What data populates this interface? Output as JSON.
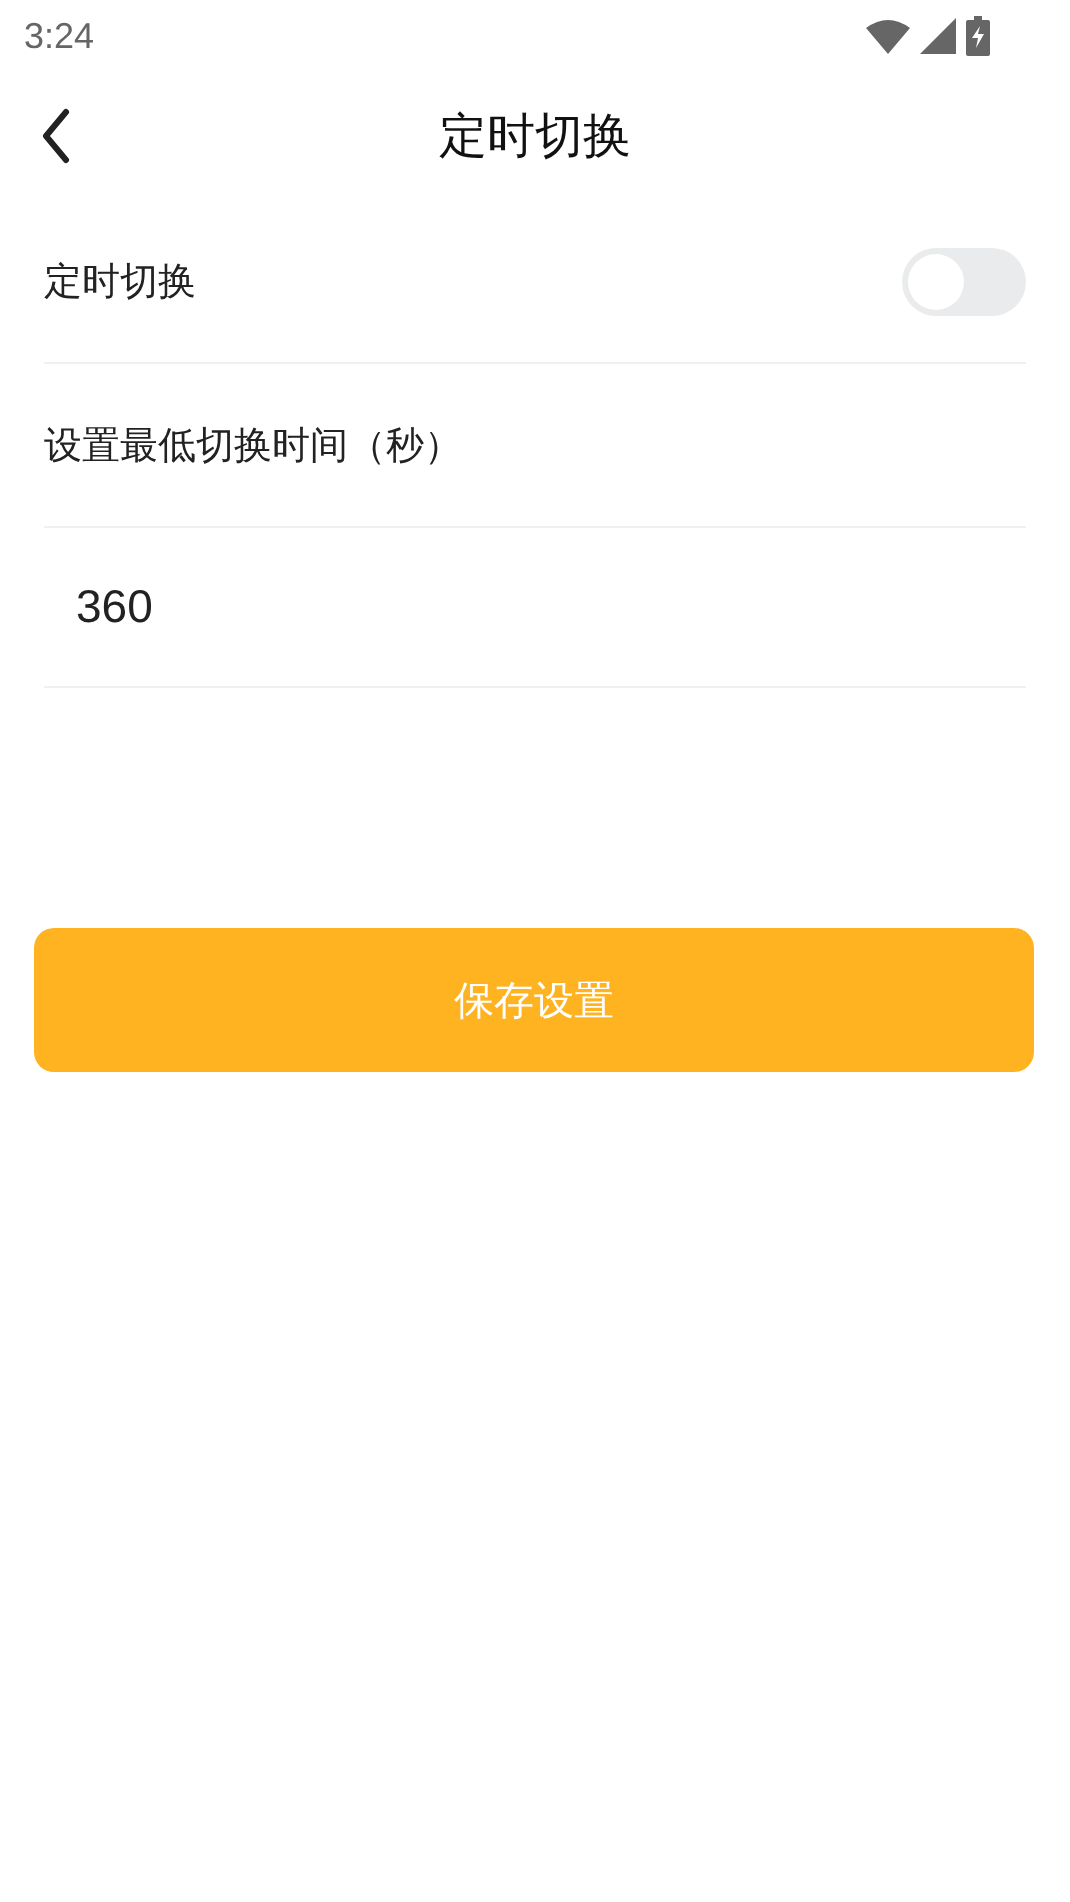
{
  "status_bar": {
    "time": "3:24"
  },
  "header": {
    "title": "定时切换"
  },
  "switch_row": {
    "label": "定时切换",
    "on": false
  },
  "time_setting": {
    "label": "设置最低切换时间（秒）",
    "value": "360"
  },
  "save_button": {
    "label": "保存设置"
  }
}
